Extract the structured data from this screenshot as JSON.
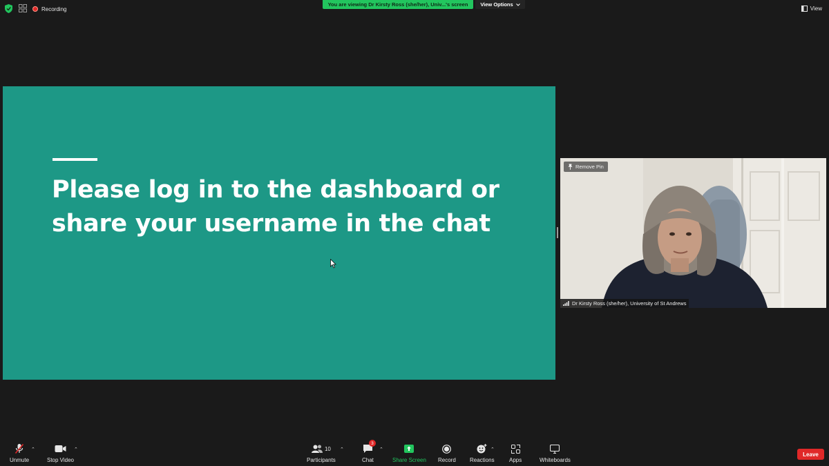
{
  "top_bar": {
    "recording_label": "Recording",
    "viewing_banner": "You are viewing Dr Kirsty Ross (she/her), Univ...'s screen",
    "view_options_label": "View Options",
    "view_label": "View"
  },
  "slide": {
    "heading_line1": "Please log in to the dashboard or",
    "heading_line2": "share your username in the chat",
    "background_color": "#1d9886"
  },
  "video": {
    "remove_pin_label": "Remove Pin",
    "participant_name": "Dr Kirsty Ross (she/her), University of St Andrews"
  },
  "toolbar": {
    "unmute_label": "Unmute",
    "stop_video_label": "Stop Video",
    "participants_label": "Participants",
    "participants_count": "10",
    "chat_label": "Chat",
    "chat_badge": "3",
    "share_screen_label": "Share Screen",
    "record_label": "Record",
    "reactions_label": "Reactions",
    "apps_label": "Apps",
    "whiteboards_label": "Whiteboards",
    "leave_label": "Leave"
  },
  "colors": {
    "background": "#1a1a1a",
    "accent_green": "#22c55e",
    "leave_red": "#e02828"
  }
}
